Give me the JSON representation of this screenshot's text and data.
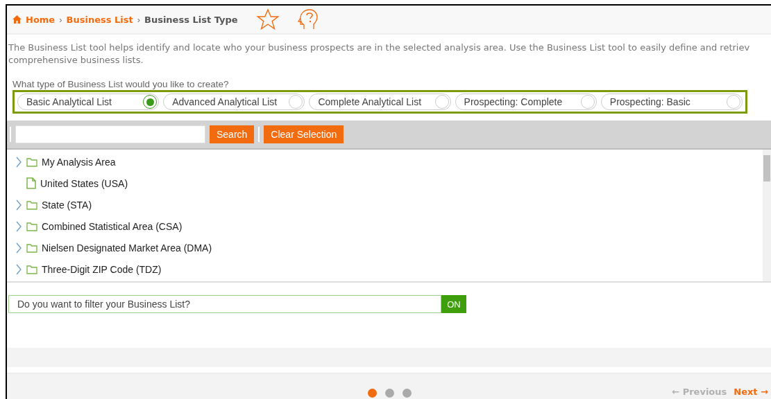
{
  "breadcrumb": [
    {
      "label": "Home",
      "link": true,
      "separator": "›"
    },
    {
      "label": "Business List",
      "link": true,
      "separator": "›"
    },
    {
      "label": "Business List Type",
      "link": false
    }
  ],
  "description": [
    "The Business List tool helps identify and locate who your business prospects are in the selected analysis area. Use the Business List tool to easily define and retriev",
    "comprehensive business lists."
  ],
  "question": "What type of Business List would you like to create?",
  "list_types": [
    {
      "label": "Basic Analytical List",
      "selected": true
    },
    {
      "label": "Advanced Analytical List",
      "selected": false
    },
    {
      "label": "Complete Analytical List",
      "selected": false
    },
    {
      "label": "Prospecting: Complete",
      "selected": false
    },
    {
      "label": "Prospecting: Basic",
      "selected": false
    }
  ],
  "toolbar": {
    "search_button": "Search",
    "clear_button": "Clear Selection"
  },
  "tree": [
    {
      "label": "My Analysis Area",
      "kind": "folder"
    },
    {
      "label": "United States (USA)",
      "kind": "file"
    },
    {
      "label": "State (STA)",
      "kind": "folder"
    },
    {
      "label": "Combined Statistical Area (CSA)",
      "kind": "folder"
    },
    {
      "label": "Nielsen Designated Market Area (DMA)",
      "kind": "folder"
    },
    {
      "label": "Three-Digit ZIP Code (TDZ)",
      "kind": "folder"
    }
  ],
  "filter": {
    "question": "Do you want to filter your Business List?",
    "toggle": "ON",
    "on": true
  },
  "pager": {
    "dots": [
      {
        "selected": true
      },
      {
        "selected": false
      },
      {
        "selected": false
      }
    ],
    "previous": {
      "label": "← Previous",
      "disabled": true
    },
    "next": {
      "label": "Next →",
      "disabled": false
    }
  }
}
